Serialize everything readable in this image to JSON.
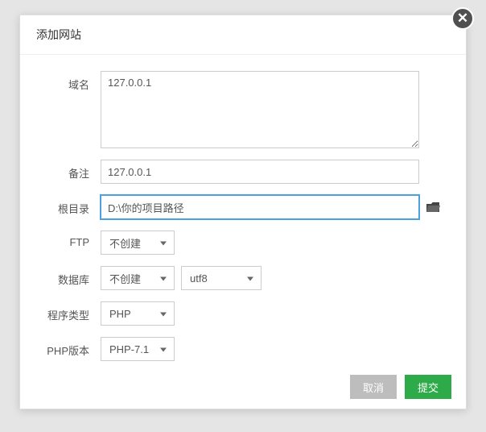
{
  "dialog": {
    "title": "添加网站",
    "close_glyph": "✕"
  },
  "form": {
    "domain": {
      "label": "域名",
      "value": "127.0.0.1"
    },
    "note": {
      "label": "备注",
      "value": "127.0.0.1"
    },
    "root": {
      "label": "根目录",
      "value": "D:\\你的项目路径"
    },
    "ftp": {
      "label": "FTP",
      "selected": "不创建"
    },
    "database": {
      "label": "数据库",
      "selected": "不创建",
      "charset": "utf8"
    },
    "program_type": {
      "label": "程序类型",
      "selected": "PHP"
    },
    "php_version": {
      "label": "PHP版本",
      "selected": "PHP-7.1"
    }
  },
  "footer": {
    "cancel": "取消",
    "submit": "提交"
  }
}
